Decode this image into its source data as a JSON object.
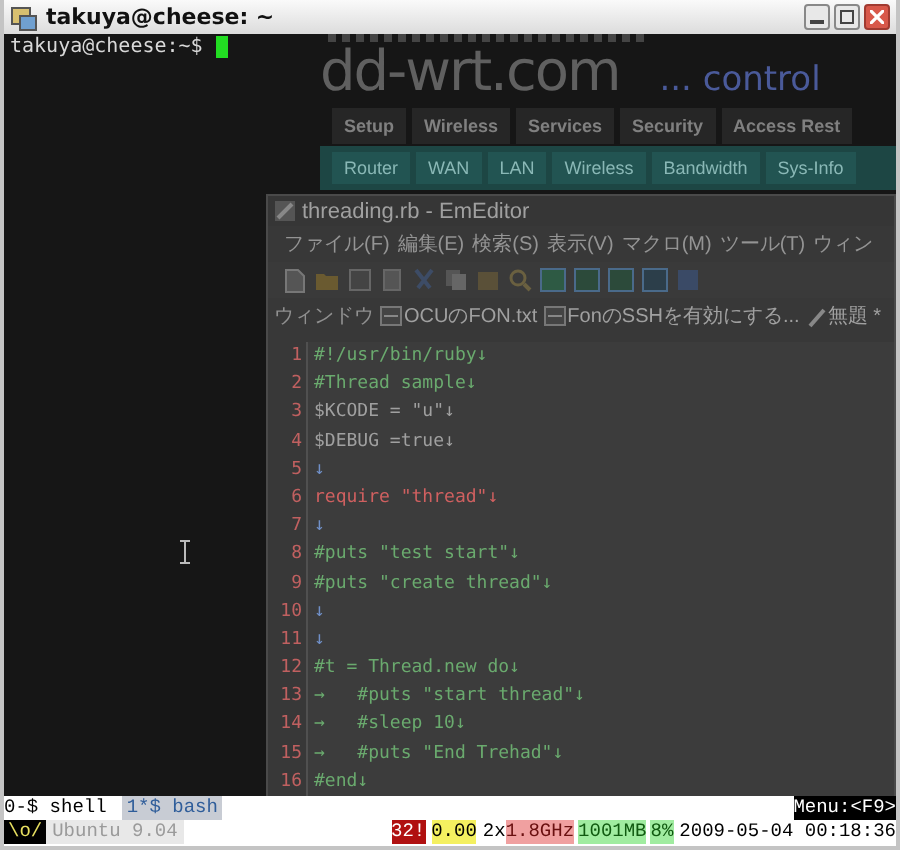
{
  "window": {
    "title": "takuya@cheese: ~"
  },
  "terminal": {
    "prompt": "takuya@cheese:~$"
  },
  "background_page": {
    "logo": "dd-wrt.com",
    "tagline": "... control",
    "main_tabs": [
      "Setup",
      "Wireless",
      "Services",
      "Security",
      "Access Rest"
    ],
    "sub_tabs": [
      "Router",
      "WAN",
      "LAN",
      "Wireless",
      "Bandwidth",
      "Sys-Info"
    ]
  },
  "editor": {
    "title": "threading.rb - EmEditor",
    "menu": [
      "ファイル(F)",
      "編集(E)",
      "検索(S)",
      "表示(V)",
      "マクロ(M)",
      "ツール(T)",
      "ウィン"
    ],
    "window_label": "ウィンドウ",
    "doc_tabs": [
      {
        "label": "OCUのFON.txt",
        "kind": "text"
      },
      {
        "label": "FonのSSHを有効にする...",
        "kind": "text"
      },
      {
        "label": "無題 *",
        "kind": "new"
      }
    ],
    "lines": [
      {
        "num": "1",
        "text": "#!/usr/bin/ruby↓",
        "kind": "comment"
      },
      {
        "num": "2",
        "text": "#Thread sample↓",
        "kind": "comment"
      },
      {
        "num": "3",
        "text": "$KCODE = \"u\"↓",
        "kind": "code"
      },
      {
        "num": "4",
        "text": "$DEBUG =true↓",
        "kind": "code"
      },
      {
        "num": "5",
        "text": "↓",
        "kind": "blank"
      },
      {
        "num": "6",
        "text": "require \"thread\"↓",
        "kind": "keyword"
      },
      {
        "num": "7",
        "text": "↓",
        "kind": "blank"
      },
      {
        "num": "8",
        "text": "#puts \"test start\"↓",
        "kind": "comment"
      },
      {
        "num": "9",
        "text": "#puts \"create thread\"↓",
        "kind": "comment"
      },
      {
        "num": "10",
        "text": "↓",
        "kind": "blank"
      },
      {
        "num": "11",
        "text": "↓",
        "kind": "blank"
      },
      {
        "num": "12",
        "text": "#t = Thread.new do↓",
        "kind": "comment"
      },
      {
        "num": "13",
        "text": "→   #puts \"start thread\"↓",
        "kind": "comment"
      },
      {
        "num": "14",
        "text": "→   #sleep 10↓",
        "kind": "comment"
      },
      {
        "num": "15",
        "text": "→   #puts \"End Trehad\"↓",
        "kind": "comment"
      },
      {
        "num": "16",
        "text": "#end↓",
        "kind": "comment"
      }
    ]
  },
  "status_bar": {
    "windows": [
      {
        "label": "0-$ shell",
        "selected": false
      },
      {
        "label": "1*$ bash",
        "selected": true
      }
    ],
    "menu_hint": "Menu:<F9>",
    "logo": "\\o/",
    "os": "Ubuntu 9.04",
    "indicators": [
      {
        "text": "32!",
        "kind": "alert"
      },
      {
        "text": "0.00",
        "kind": "load"
      },
      {
        "text": "2x",
        "kind": "plain"
      },
      {
        "text": "1.8GHz",
        "kind": "cpu"
      },
      {
        "text": "1001MB",
        "kind": "mem"
      },
      {
        "text": "8%",
        "kind": "mem"
      },
      {
        "text": "2009-05-04 00:18:36",
        "kind": "plain"
      }
    ]
  }
}
